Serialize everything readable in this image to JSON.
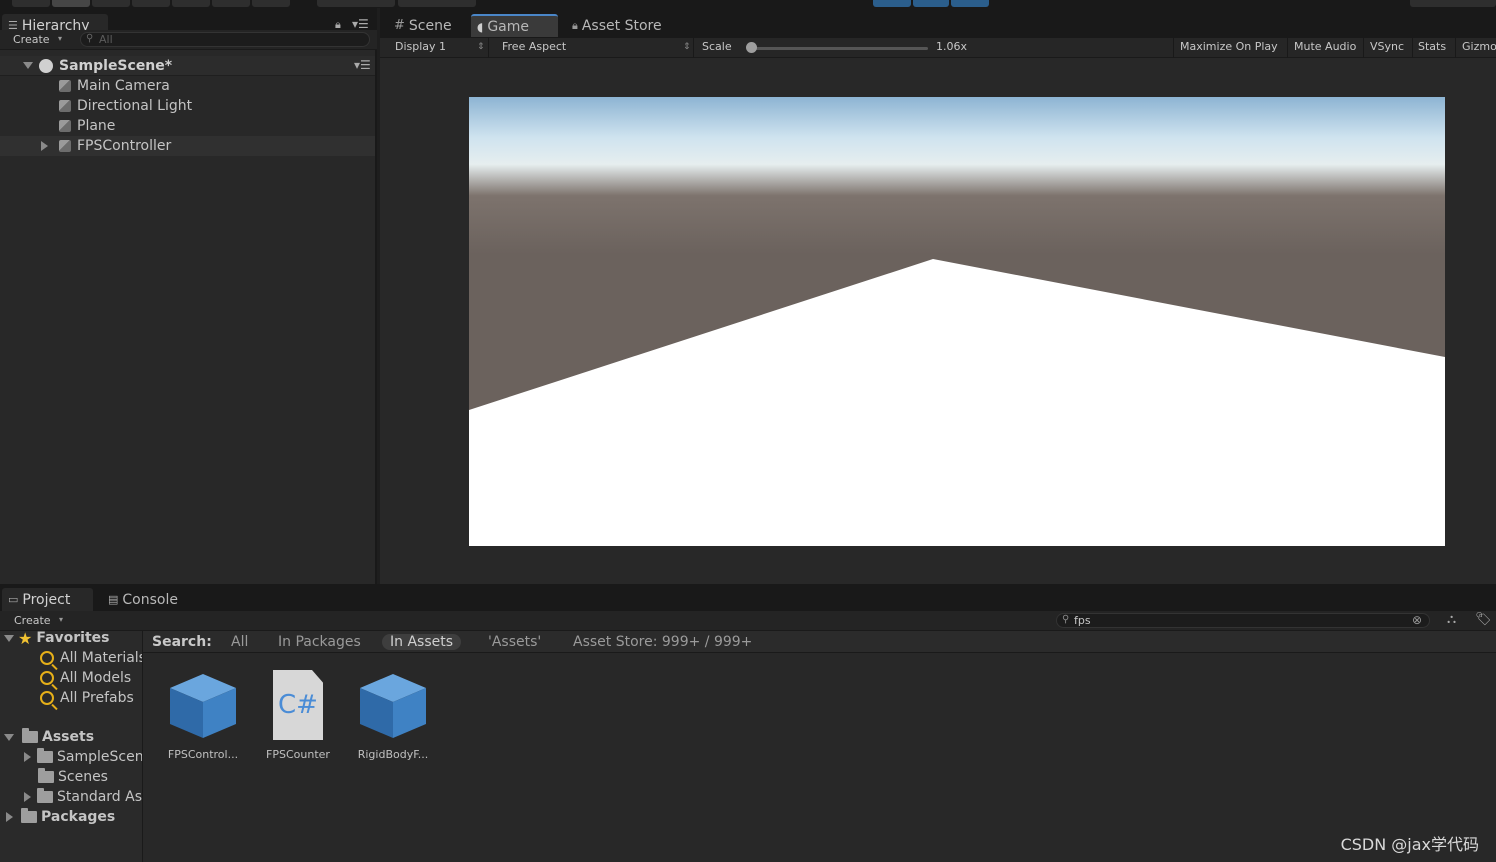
{
  "hierarchy": {
    "tab_label": "Hierarchy",
    "create_label": "Create",
    "search_placeholder": "All",
    "scene_name": "SampleScene*",
    "items": [
      {
        "label": "Main Camera"
      },
      {
        "label": "Directional Light"
      },
      {
        "label": "Plane"
      },
      {
        "label": "FPSController"
      }
    ]
  },
  "game_tabs": {
    "scene": "Scene",
    "game": "Game",
    "asset_store": "Asset Store"
  },
  "game_toolbar": {
    "display": "Display 1",
    "aspect": "Free Aspect",
    "scale_label": "Scale",
    "scale_value": "1.06x",
    "maximize": "Maximize On Play",
    "mute": "Mute Audio",
    "vsync": "VSync",
    "stats": "Stats",
    "gizmos": "Gizmo"
  },
  "project": {
    "tab_project": "Project",
    "tab_console": "Console",
    "create_label": "Create",
    "search_value": "fps",
    "search_label": "Search:",
    "filters": {
      "all": "All",
      "in_packages": "In Packages",
      "in_assets": "In Assets",
      "assets_folder": "'Assets'",
      "asset_store": "Asset Store: 999+ / 999+"
    },
    "favorites_label": "Favorites",
    "favorites": [
      "All Materials",
      "All Models",
      "All Prefabs"
    ],
    "assets_label": "Assets",
    "assets_children": [
      "SampleScen",
      "Scenes",
      "Standard As"
    ],
    "packages_label": "Packages",
    "results": [
      {
        "label": "FPSControl...",
        "icon": "prefab-icon"
      },
      {
        "label": "FPSCounter",
        "icon": "csharp-script-icon"
      },
      {
        "label": "RigidBodyF...",
        "icon": "prefab-icon"
      }
    ]
  },
  "watermark": "CSDN @jax学代码",
  "colors": {
    "sky_top": "#9ec4e0",
    "horizon": "#6b625d",
    "ground": "#ffffff",
    "accent": "#4a86c8"
  }
}
